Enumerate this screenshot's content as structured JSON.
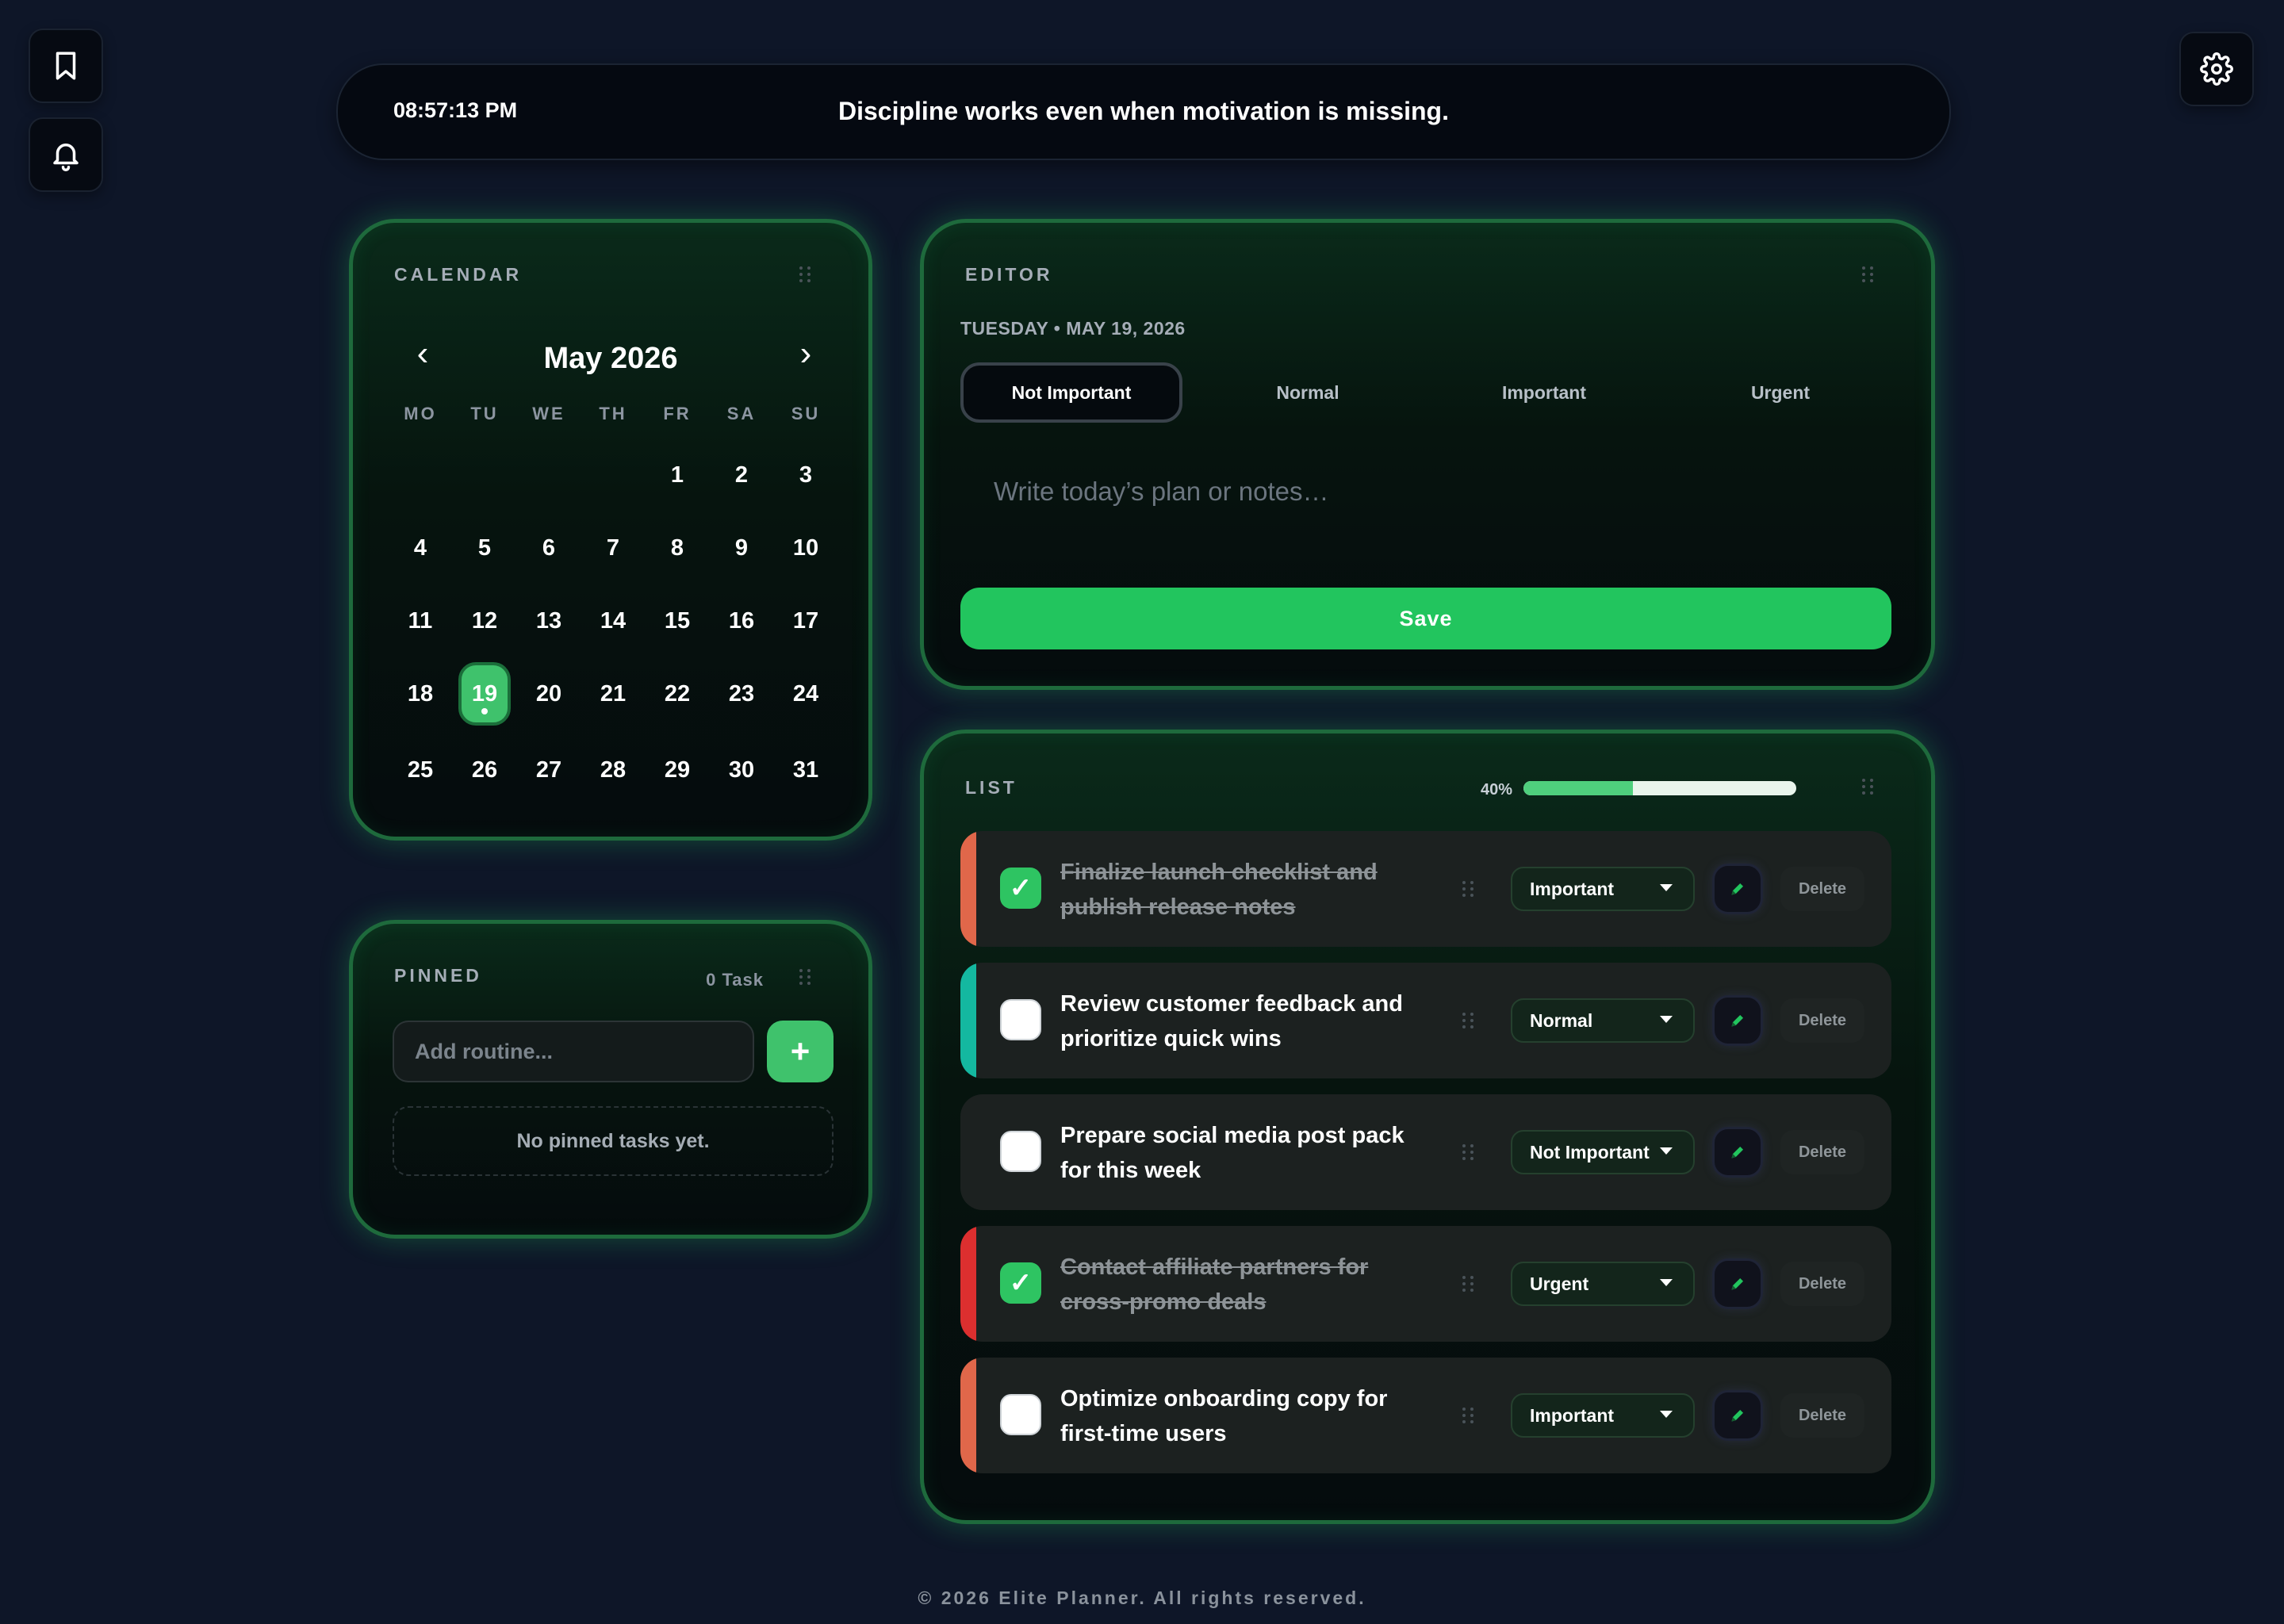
{
  "clock": "08:57:13 PM",
  "quote": "Discipline works even when motivation is missing.",
  "calendar": {
    "title": "CALENDAR",
    "month_label": "May 2026",
    "prev_symbol": "‹",
    "next_symbol": "›",
    "weekdays": [
      "MO",
      "TU",
      "WE",
      "TH",
      "FR",
      "SA",
      "SU"
    ],
    "weeks": [
      [
        "",
        "",
        "",
        "",
        "1",
        "2",
        "3"
      ],
      [
        "4",
        "5",
        "6",
        "7",
        "8",
        "9",
        "10"
      ],
      [
        "11",
        "12",
        "13",
        "14",
        "15",
        "16",
        "17"
      ],
      [
        "18",
        "19",
        "20",
        "21",
        "22",
        "23",
        "24"
      ],
      [
        "25",
        "26",
        "27",
        "28",
        "29",
        "30",
        "31"
      ]
    ],
    "selected_day": "19"
  },
  "pinned": {
    "title": "PINNED",
    "count_label": "0 Task",
    "input_placeholder": "Add routine...",
    "add_symbol": "+",
    "empty_text": "No pinned tasks yet."
  },
  "editor": {
    "title": "EDITOR",
    "date_label": "TUESDAY • MAY 19, 2026",
    "priorities": [
      "Not Important",
      "Normal",
      "Important",
      "Urgent"
    ],
    "active_priority": "Not Important",
    "notes_placeholder": "Write today’s plan or notes…",
    "save_label": "Save"
  },
  "list": {
    "title": "LIST",
    "progress_label": "40%",
    "progress": 0.4,
    "delete_label": "Delete",
    "tasks": [
      {
        "line1": "Finalize launch checklist and",
        "line2": "publish release notes",
        "done": true,
        "priority": "Important",
        "accent": "#e0674a"
      },
      {
        "line1": "Review customer feedback and",
        "line2": "prioritize quick wins",
        "done": false,
        "priority": "Normal",
        "accent": "#14b8a0"
      },
      {
        "line1": "Prepare social media post pack",
        "line2": "for this week",
        "done": false,
        "priority": "Not Important",
        "accent": ""
      },
      {
        "line1": "Contact affiliate partners for",
        "line2": "cross-promo deals",
        "done": true,
        "priority": "Urgent",
        "accent": "#dc2f2f"
      },
      {
        "line1": "Optimize onboarding copy for",
        "line2": "first-time users",
        "done": false,
        "priority": "Important",
        "accent": "#e0674a"
      }
    ]
  },
  "footer": "© 2026 Elite Planner. All rights reserved.",
  "colors": {
    "accent_green": "#22c55e",
    "background": "#0e1628",
    "important": "#e0674a",
    "normal": "#14b8a0",
    "urgent": "#dc2f2f"
  },
  "icons": {
    "sidebar": [
      "bookmark-icon",
      "bell-icon"
    ],
    "settings": "gear-icon",
    "task_edit": "pencil-icon",
    "drag": "grip-dots-icon"
  }
}
